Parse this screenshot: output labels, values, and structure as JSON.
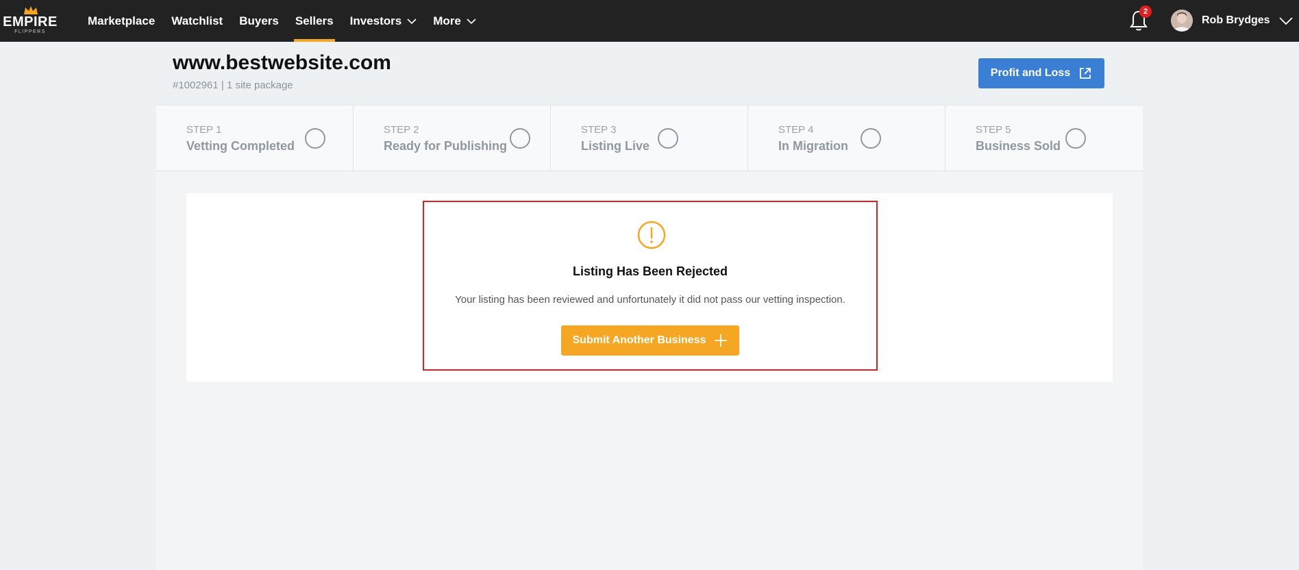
{
  "brand": {
    "name": "EMPIRE",
    "tagline": "FLIPPERS"
  },
  "nav": {
    "items": [
      {
        "label": "Marketplace"
      },
      {
        "label": "Watchlist"
      },
      {
        "label": "Buyers"
      },
      {
        "label": "Sellers",
        "active": true
      },
      {
        "label": "Investors",
        "dropdown": true
      },
      {
        "label": "More",
        "dropdown": true
      }
    ]
  },
  "notifications": {
    "count": "2"
  },
  "user": {
    "name": "Rob Brydges"
  },
  "listing": {
    "title": "www.bestwebsite.com",
    "subtitle": "#1002961 | 1 site package",
    "pl_button": "Profit and Loss"
  },
  "steps": [
    {
      "num": "STEP 1",
      "label": "Vetting Completed"
    },
    {
      "num": "STEP 2",
      "label": "Ready for Publishing"
    },
    {
      "num": "STEP 3",
      "label": "Listing Live"
    },
    {
      "num": "STEP 4",
      "label": "In Migration"
    },
    {
      "num": "STEP 5",
      "label": "Business Sold"
    }
  ],
  "rejection": {
    "title": "Listing Has Been Rejected",
    "message": "Your listing has been reviewed and unfortunately it did not pass our vetting inspection.",
    "button": "Submit Another Business"
  },
  "colors": {
    "accent": "#f5a623",
    "primary": "#3b7fd4",
    "error": "#e02020",
    "topbar": "#222222"
  }
}
